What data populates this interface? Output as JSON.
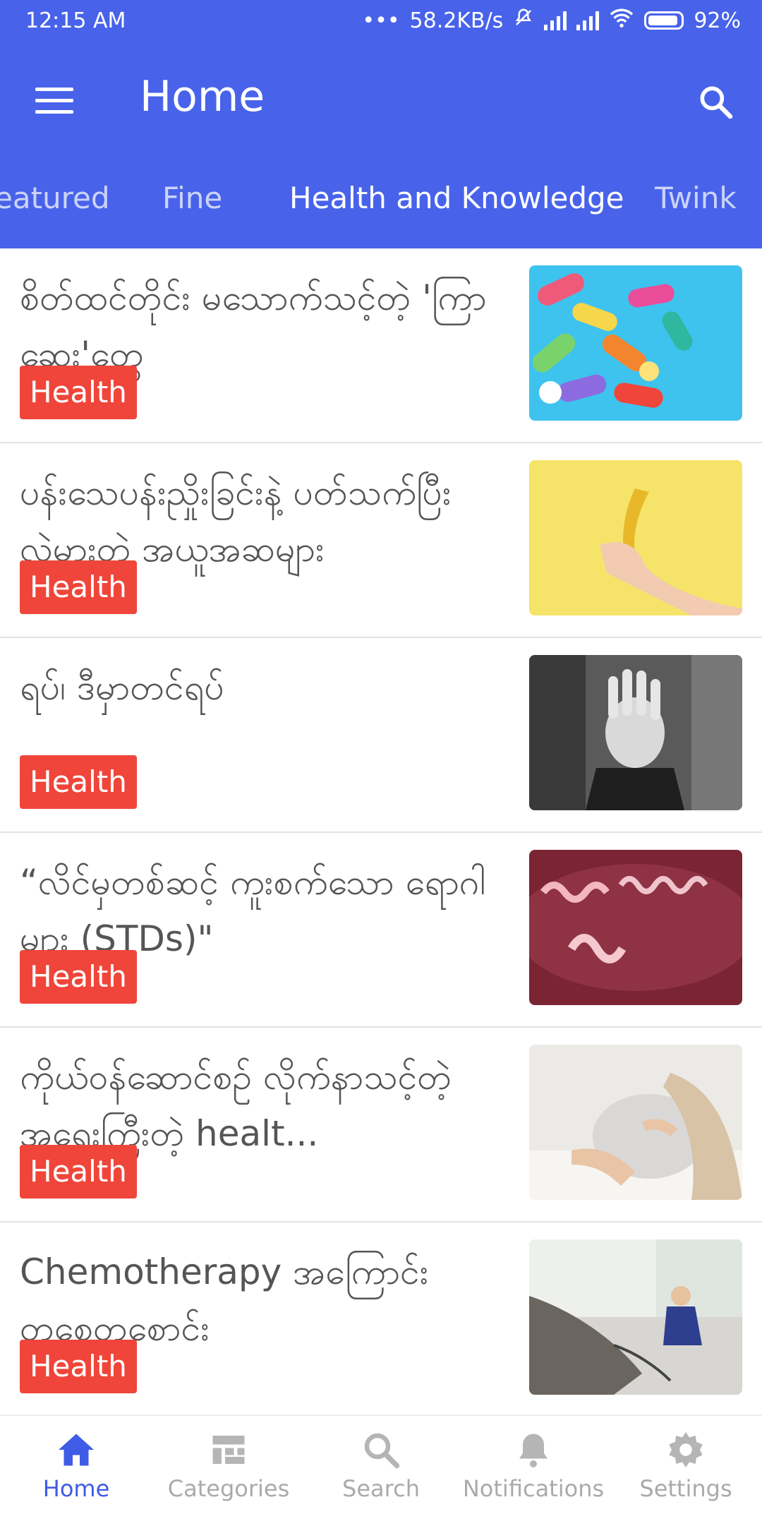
{
  "status": {
    "time": "12:15 AM",
    "network_speed": "58.2KB/s",
    "battery": "92%",
    "battery_level": 0.92
  },
  "toolbar": {
    "title": "Home"
  },
  "tabs": [
    {
      "label": "eatured"
    },
    {
      "label": "Fine"
    },
    {
      "label": "Health and Knowledge",
      "active": true
    },
    {
      "label": "Twink"
    }
  ],
  "articles": [
    {
      "title": "စိတ်ထင်တိုင်း မသောက်သင့်တဲ့ 'ကြာဆေး'တွေ",
      "category": "Health",
      "image": "pills-image"
    },
    {
      "title": "ပန်းသေပန်းညှိုးခြင်းနဲ့ ပတ်သက်ပြီး လွဲမှားတဲ့ အယူအဆများ",
      "category": "Health",
      "image": "banana-image"
    },
    {
      "title": "ရပ်၊ ဒီမှာတင်ရပ်",
      "category": "Health",
      "image": "stop-hand-image"
    },
    {
      "title": "“လိင်မှတစ်ဆင့် ကူးစက်သော ရောဂါများ (STDs)\"",
      "category": "Health",
      "image": "bacteria-image"
    },
    {
      "title": "ကိုယ်ဝန်ဆောင်စဉ် လိုက်နာသင့်တဲ့ အရေးကြီးတဲ့ healt...",
      "category": "Health",
      "image": "pregnancy-image"
    },
    {
      "title": "Chemotherapy အကြောင်း တစေတစောင်း",
      "category": "Health",
      "image": "chemotherapy-image"
    }
  ],
  "bottom_nav": [
    {
      "label": "Home",
      "icon": "home-icon",
      "active": true
    },
    {
      "label": "Categories",
      "icon": "categories-icon"
    },
    {
      "label": "Search",
      "icon": "search-icon"
    },
    {
      "label": "Notifications",
      "icon": "bell-icon"
    },
    {
      "label": "Settings",
      "icon": "gear-icon"
    }
  ],
  "colors": {
    "primary": "#4863ea",
    "badge": "#f0453a",
    "nav_active": "#3f5ce6",
    "nav_inactive": "#aaaaaa"
  }
}
